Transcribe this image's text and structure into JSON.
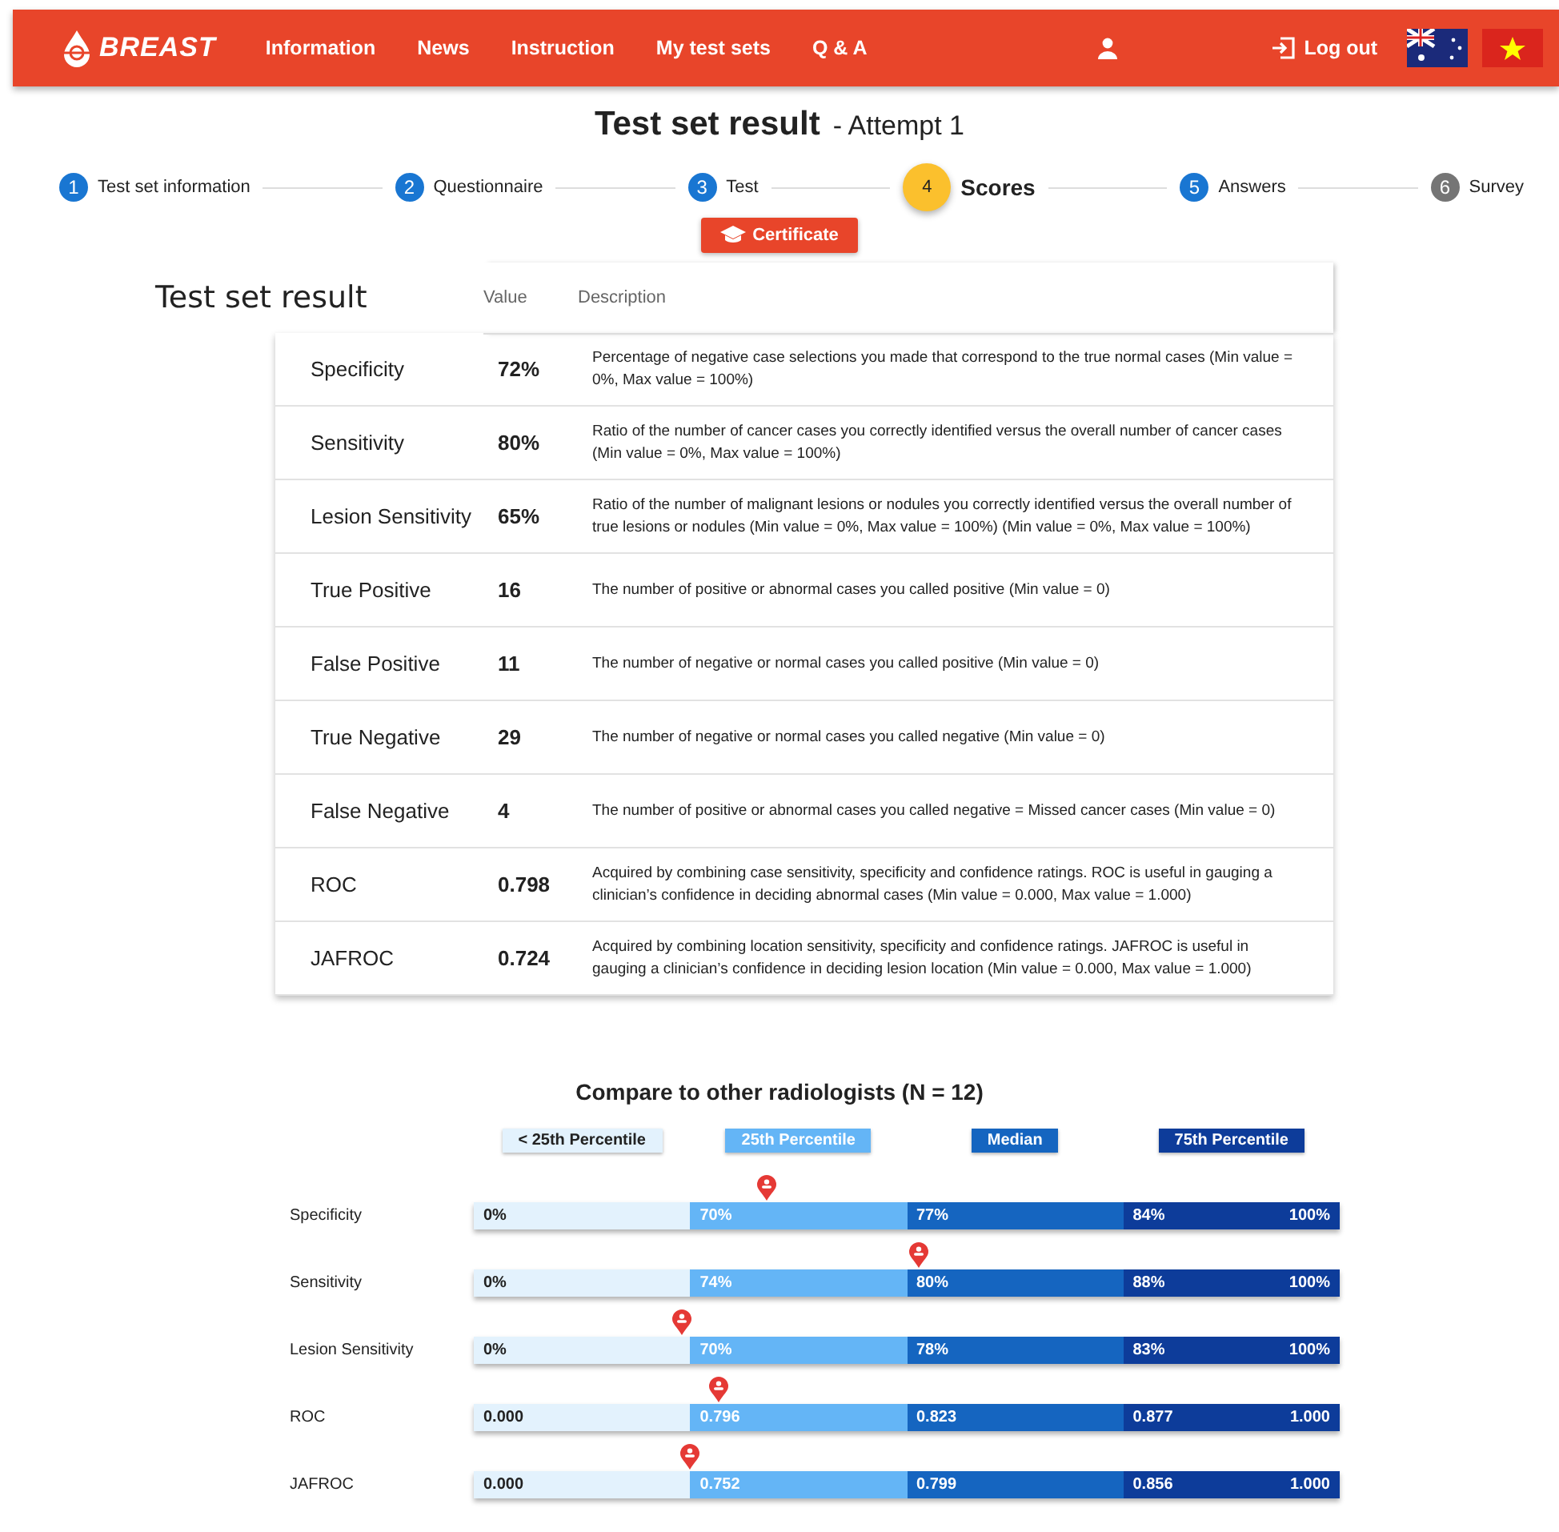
{
  "nav": {
    "brand": "BREAST",
    "links": [
      "Information",
      "News",
      "Instruction",
      "My test sets",
      "Q & A"
    ],
    "logout": "Log out"
  },
  "title": {
    "main": "Test set result",
    "sub": "- Attempt 1"
  },
  "steps": [
    {
      "number": "1",
      "label": "Test set information",
      "selected": false,
      "disabled": false
    },
    {
      "number": "2",
      "label": "Questionnaire",
      "selected": false,
      "disabled": false
    },
    {
      "number": "3",
      "label": "Test",
      "selected": false,
      "disabled": false
    },
    {
      "number": "4",
      "label": "Scores",
      "selected": true,
      "disabled": false
    },
    {
      "number": "5",
      "label": "Answers",
      "selected": false,
      "disabled": false
    },
    {
      "number": "6",
      "label": "Survey",
      "selected": false,
      "disabled": true
    }
  ],
  "certificate_button": "Certificate",
  "result_table": {
    "heading": "Test set result",
    "columns": [
      "Value",
      "Description"
    ],
    "rows": [
      {
        "name": "Specificity",
        "value": "72%",
        "description": "Percentage of negative case selections you made that correspond to the true normal cases (Min value = 0%, Max value = 100%)"
      },
      {
        "name": "Sensitivity",
        "value": "80%",
        "description": "Ratio of the number of cancer cases you correctly identified versus the overall number of cancer cases (Min value = 0%, Max value = 100%)"
      },
      {
        "name": "Lesion Sensitivity",
        "value": "65%",
        "description": "Ratio of the number of malignant lesions or nodules you correctly identified versus the overall number of true lesions or nodules (Min value = 0%, Max value = 100%) (Min value = 0%, Max value = 100%)"
      },
      {
        "name": "True Positive",
        "value": "16",
        "description": "The number of positive or abnormal cases you called positive (Min value = 0)"
      },
      {
        "name": "False Positive",
        "value": "11",
        "description": "The number of negative or normal cases you called positive (Min value = 0)"
      },
      {
        "name": "True Negative",
        "value": "29",
        "description": "The number of negative or normal cases you called negative (Min value = 0)"
      },
      {
        "name": "False Negative",
        "value": "4",
        "description": "The number of positive or abnormal cases you called negative = Missed cancer cases (Min value = 0)"
      },
      {
        "name": "ROC",
        "value": "0.798",
        "description": "Acquired by combining case sensitivity, specificity and confidence ratings. ROC is useful in gauging a clinician’s confidence in deciding abnormal cases (Min value = 0.000, Max value = 1.000)"
      },
      {
        "name": "JAFROC",
        "value": "0.724",
        "description": "Acquired by combining location sensitivity, specificity and confidence ratings. JAFROC is useful in gauging a clinician’s confidence in deciding lesion location (Min value = 0.000, Max value = 1.000)"
      }
    ]
  },
  "comparison": {
    "title": "Compare to other radiologists (N = 12)",
    "legend": [
      "< 25th Percentile",
      "25th Percentile",
      "Median",
      "75th Percentile"
    ],
    "rows": [
      {
        "name": "Specificity",
        "ticks": [
          "0%",
          "70%",
          "77%",
          "84%"
        ],
        "max": "100%",
        "level": 0.338
      },
      {
        "name": "Sensitivity",
        "ticks": [
          "0%",
          "74%",
          "80%",
          "88%"
        ],
        "max": "100%",
        "level": 0.514
      },
      {
        "name": "Lesion Sensitivity",
        "ticks": [
          "0%",
          "70%",
          "78%",
          "83%"
        ],
        "max": "100%",
        "level": 0.24
      },
      {
        "name": "ROC",
        "ticks": [
          "0.000",
          "0.796",
          "0.823",
          "0.877"
        ],
        "max": "1.000",
        "level": 0.283
      },
      {
        "name": "JAFROC",
        "ticks": [
          "0.000",
          "0.752",
          "0.799",
          "0.856"
        ],
        "max": "1.000",
        "level": 0.25
      }
    ]
  }
}
